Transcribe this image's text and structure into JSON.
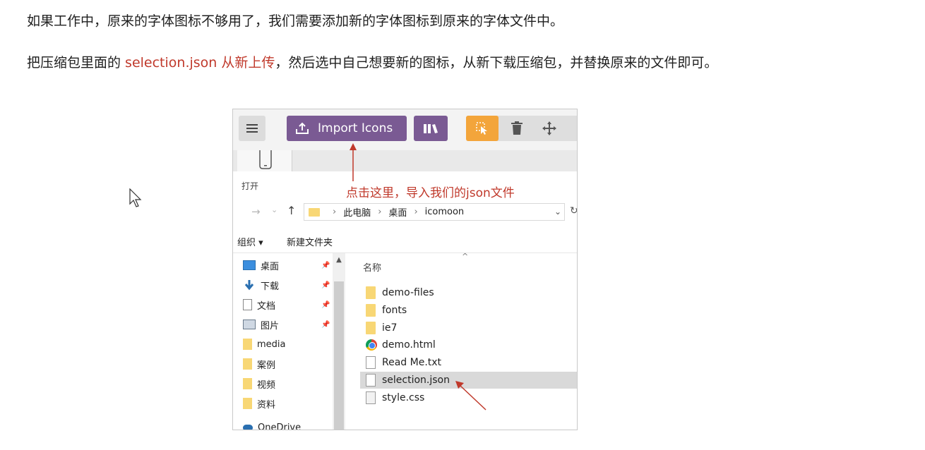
{
  "doc": {
    "para1": "如果工作中，原来的字体图标不够用了，我们需要添加新的字体图标到原来的字体文件中。",
    "para2_before": "把压缩包里面的 ",
    "para2_highlight": "selection.json 从新上传",
    "para2_after": "，然后选中自己想要新的图标，从新下载压缩包，并替换原来的文件即可。"
  },
  "figure": {
    "toolbar": {
      "import_label": "Import Icons"
    },
    "dialog_title": "打开",
    "annotation": "点击这里，导入我们的json文件",
    "address": {
      "crumb1": "此电脑",
      "crumb2": "桌面",
      "crumb3": "icomoon"
    },
    "commands": {
      "organize": "组织 ▾",
      "new_folder": "新建文件夹"
    },
    "sidebar": {
      "items": [
        "桌面",
        "下载",
        "文档",
        "图片",
        "media",
        "案例",
        "视频",
        "资料",
        "OneDrive"
      ]
    },
    "files": {
      "column_name": "名称",
      "items": [
        "demo-files",
        "fonts",
        "ie7",
        "demo.html",
        "Read Me.txt",
        "selection.json",
        "style.css"
      ]
    },
    "colors": {
      "brand_purple": "#7a5a93",
      "select_orange": "#f3a53b",
      "annotation_red": "#c0392b"
    }
  }
}
